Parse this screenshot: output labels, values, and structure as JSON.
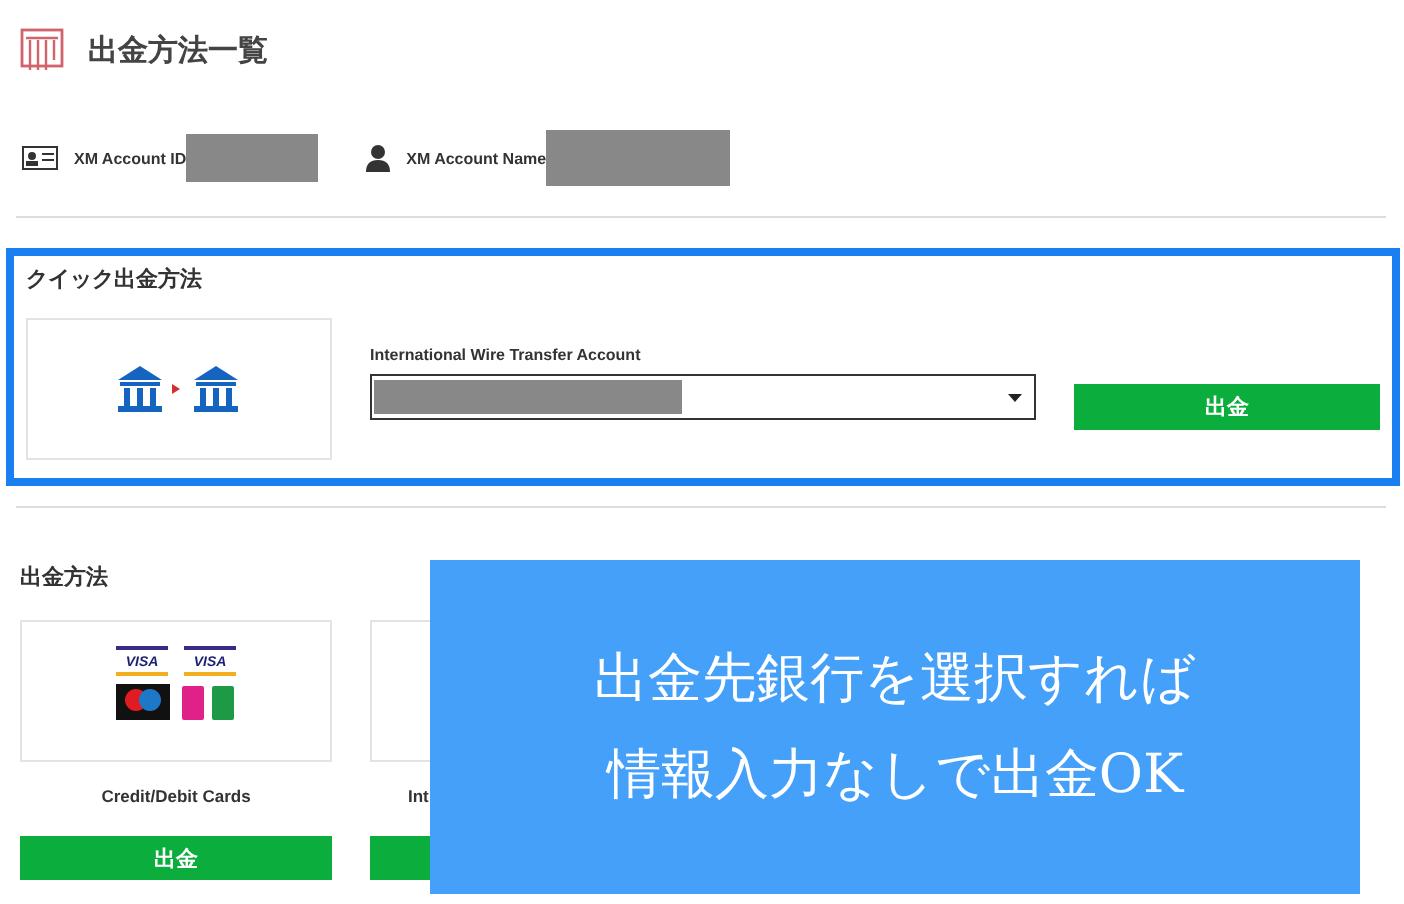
{
  "title": "出金方法一覧",
  "account": {
    "id_label": "XM Account ID",
    "name_label": "XM Account Name"
  },
  "quick": {
    "title": "クイック出金方法",
    "field_label": "International Wire Transfer Account",
    "button": "出金"
  },
  "methods_title": "出金方法",
  "methods": [
    {
      "kind": "cards",
      "logos": [
        "VISA",
        "VISA"
      ],
      "label": "Credit/Debit Cards",
      "button": "出金"
    },
    {
      "kind": "partial",
      "label": "Int"
    }
  ],
  "overlay": {
    "lines": [
      "出金先銀行を選択すれば",
      "情報入力なしで出金OK"
    ]
  }
}
